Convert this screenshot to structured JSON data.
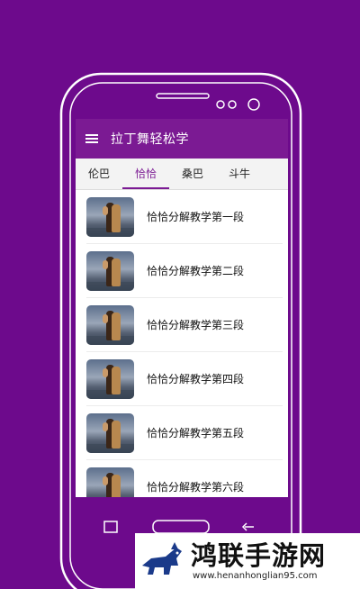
{
  "app": {
    "title": "拉丁舞轻松学"
  },
  "tabs": [
    {
      "label": "伦巴",
      "active": false
    },
    {
      "label": "恰恰",
      "active": true
    },
    {
      "label": "桑巴",
      "active": false
    },
    {
      "label": "斗牛",
      "active": false
    }
  ],
  "items": [
    {
      "label": "恰恰分解教学第一段"
    },
    {
      "label": "恰恰分解教学第二段"
    },
    {
      "label": "恰恰分解教学第三段"
    },
    {
      "label": "恰恰分解教学第四段"
    },
    {
      "label": "恰恰分解教学第五段"
    },
    {
      "label": "恰恰分解教学第六段"
    }
  ],
  "watermark": {
    "title": "鸿联手游网",
    "url": "www.henanhonglian95.com"
  },
  "colors": {
    "background": "#6d0a8c",
    "accent": "#7b1a93",
    "screen": "#ffffff"
  }
}
